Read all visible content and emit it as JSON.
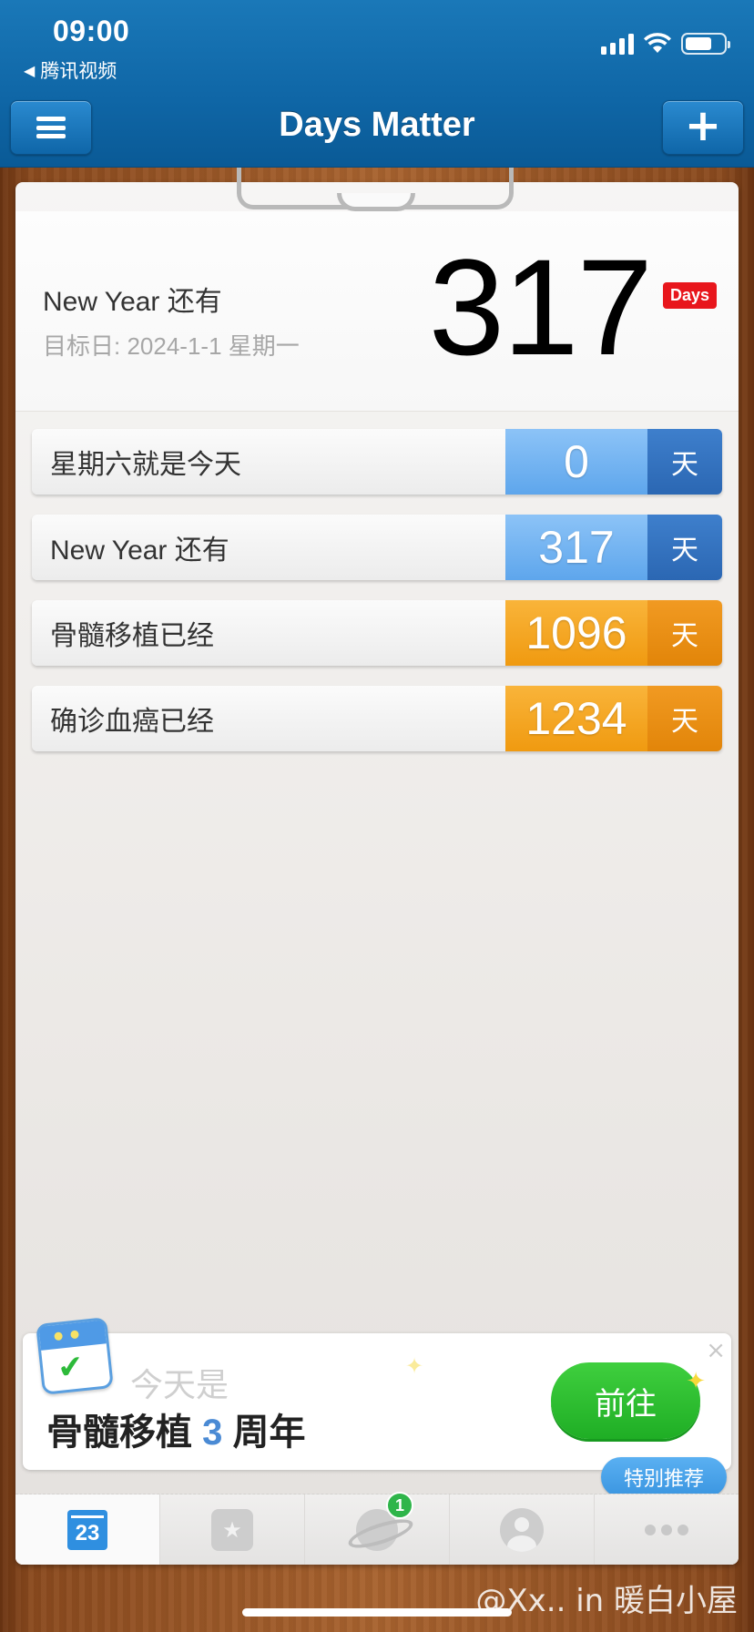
{
  "status_bar": {
    "time": "09:00",
    "back_app": "腾讯视频",
    "signal_icon": "cellular-signal-icon",
    "wifi_icon": "wifi-icon",
    "battery_icon": "battery-icon",
    "battery_level": 0.7
  },
  "nav": {
    "title": "Days Matter",
    "menu_icon": "hamburger-menu-icon",
    "add_icon": "plus-icon",
    "add_label": "+"
  },
  "featured": {
    "title": "New Year 还有",
    "subtitle": "目标日: 2024-1-1 星期一",
    "number": "317",
    "badge": "Days"
  },
  "events": [
    {
      "name": "星期六就是今天",
      "days": "0",
      "unit": "天",
      "color": "blue"
    },
    {
      "name": "New Year 还有",
      "days": "317",
      "unit": "天",
      "color": "blue"
    },
    {
      "name": "骨髓移植已经",
      "days": "1096",
      "unit": "天",
      "color": "orange"
    },
    {
      "name": "确诊血癌已经",
      "days": "1234",
      "unit": "天",
      "color": "orange"
    }
  ],
  "colors": {
    "nav_blue": "#0f66a6",
    "future_blue": "#5ea6ec",
    "past_orange": "#f09a10",
    "badge_red": "#e8161c",
    "go_green": "#1fae25"
  },
  "promo": {
    "lead": "今天是",
    "main_prefix": "骨髓移植 ",
    "main_highlight": "3",
    "main_suffix": " 周年",
    "button": "前往",
    "close": "×",
    "tag": "特别推荐",
    "icon": "calendar-check-icon"
  },
  "tabbar": {
    "tabs": [
      {
        "icon": "calendar-icon",
        "label": "23"
      },
      {
        "icon": "star-list-icon"
      },
      {
        "icon": "planet-icon",
        "badge": "1"
      },
      {
        "icon": "person-icon"
      },
      {
        "icon": "more-dots-icon"
      }
    ]
  },
  "watermark": "@Xx.. in 暖白小屋"
}
